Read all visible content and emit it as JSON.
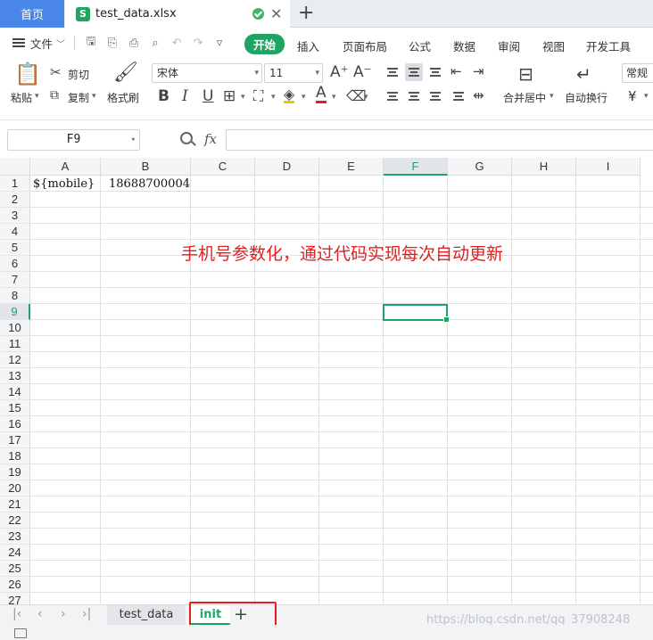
{
  "tabs": {
    "home": "首页",
    "file_icon_letter": "S",
    "file_name": "test_data.xlsx",
    "new_tab_symbol": "+"
  },
  "menu": {
    "file": "文件",
    "items": [
      "开始",
      "插入",
      "页面布局",
      "公式",
      "数据",
      "审阅",
      "视图",
      "开发工具"
    ],
    "active": "开始"
  },
  "ribbon": {
    "paste": "粘贴",
    "cut": "剪切",
    "copy": "复制",
    "format_painter": "格式刷",
    "font_name": "宋体",
    "font_size": "11",
    "merge_center": "合并居中",
    "wrap_text": "自动换行",
    "number_format": "常规",
    "currency_symbol": "¥"
  },
  "formula_bar": {
    "cell_ref": "F9",
    "fx": "fx",
    "formula": ""
  },
  "sheet": {
    "columns": [
      "A",
      "B",
      "C",
      "D",
      "E",
      "F",
      "G",
      "H",
      "I"
    ],
    "selected_column": "F",
    "rows": [
      "1",
      "2",
      "3",
      "4",
      "5",
      "6",
      "7",
      "8",
      "9",
      "10",
      "11",
      "12",
      "13",
      "14",
      "15",
      "16",
      "17",
      "18",
      "19",
      "20",
      "21",
      "22",
      "23",
      "24",
      "25",
      "26",
      "27"
    ],
    "selected_row": "9",
    "cells": {
      "A1": "${mobile}",
      "B1": "18688700004"
    },
    "annotation": "手机号参数化，通过代码实现每次自动更新"
  },
  "sheet_tabs": {
    "tabs": [
      "test_data",
      "init"
    ],
    "active": "init",
    "add_symbol": "+"
  },
  "watermark": "https://blog.csdn.net/qq_37908248",
  "colors": {
    "accent_green": "#1fa463",
    "home_tab_blue": "#4a86e8",
    "annotation_red": "#e02020"
  }
}
